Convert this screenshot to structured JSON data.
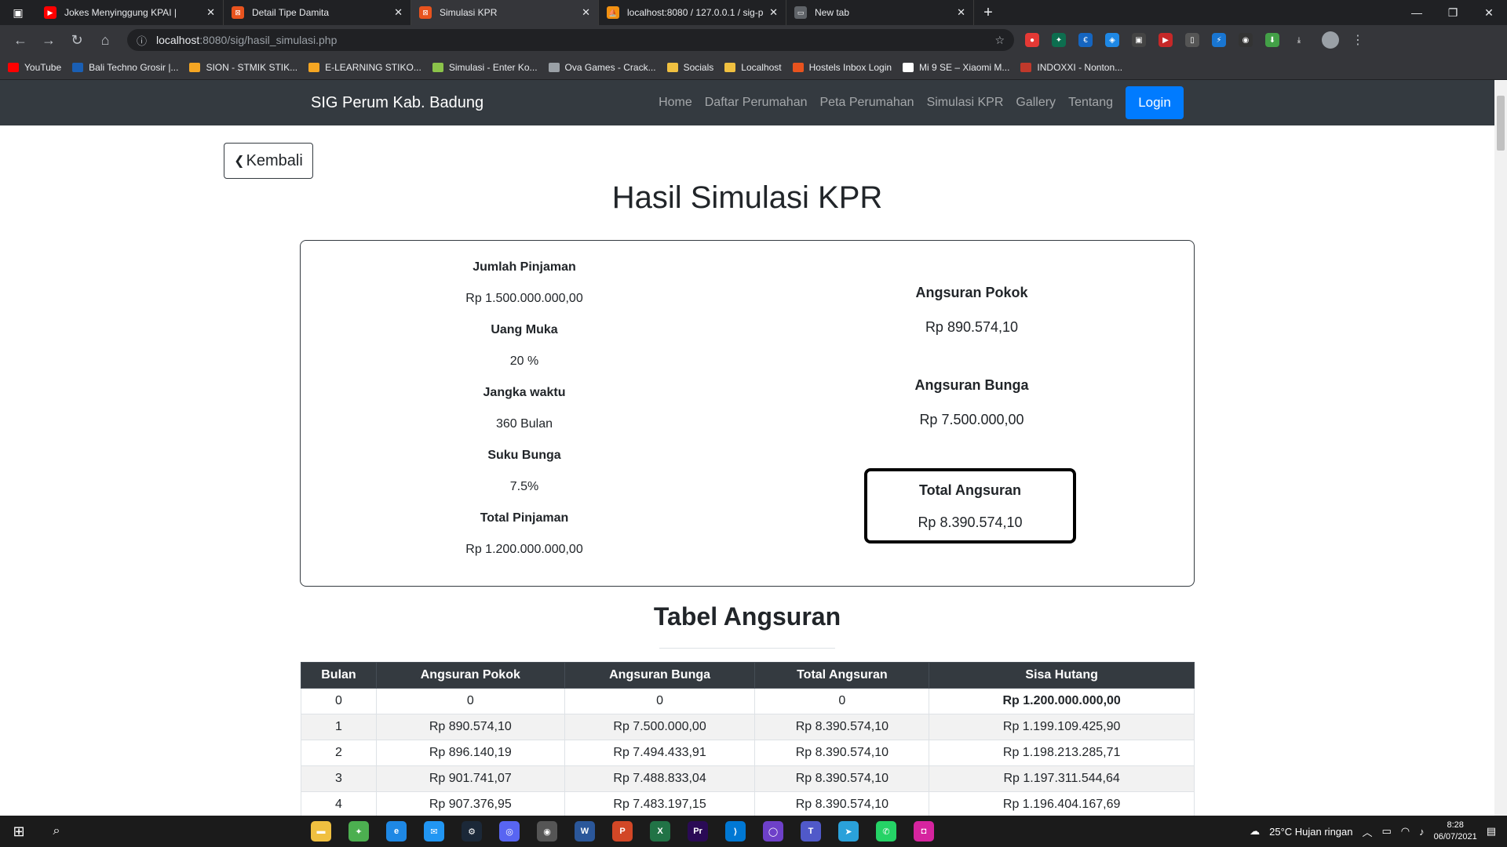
{
  "browser": {
    "tabs": [
      {
        "title": "Jokes Menyinggung KPAI | ",
        "fav_color": "#ff0000",
        "fav_glyph": "▶"
      },
      {
        "title": "Detail Tipe Damita",
        "fav_color": "#e8531e",
        "fav_glyph": "⊠"
      },
      {
        "title": "Simulasi KPR",
        "fav_color": "#e8531e",
        "fav_glyph": "⊠"
      },
      {
        "title": "localhost:8080 / 127.0.0.1 / sig-p",
        "fav_color": "#f29111",
        "fav_glyph": "⛵"
      },
      {
        "title": "New tab",
        "fav_color": "#5f6368",
        "fav_glyph": "▭"
      }
    ],
    "url_host": "localhost",
    "url_path": ":8080/sig/hasil_simulasi.php",
    "bookmarks": [
      {
        "label": "YouTube",
        "color": "#ff0000"
      },
      {
        "label": "Bali Techno Grosir |...",
        "color": "#1a5fb4"
      },
      {
        "label": "SION - STMIK STIK...",
        "color": "#f5a623"
      },
      {
        "label": "E-LEARNING STIKO...",
        "color": "#f5a623"
      },
      {
        "label": "Simulasi - Enter Ko...",
        "color": "#8bc34a"
      },
      {
        "label": "Ova Games - Crack...",
        "color": "#9aa0a6"
      },
      {
        "label": "Socials",
        "color": "#f0c040"
      },
      {
        "label": "Localhost",
        "color": "#f0c040"
      },
      {
        "label": "Hostels Inbox Login",
        "color": "#e8531e"
      },
      {
        "label": "Mi 9 SE – Xiaomi M...",
        "color": "#ffffff"
      },
      {
        "label": "INDOXXI - Nonton...",
        "color": "#c0392b"
      }
    ]
  },
  "navbar": {
    "brand": "SIG Perum Kab. Badung",
    "links": [
      "Home",
      "Daftar Perumahan",
      "Peta Perumahan",
      "Simulasi KPR",
      "Gallery",
      "Tentang"
    ],
    "login": "Login"
  },
  "page": {
    "back": "Kembali",
    "title": "Hasil Simulasi KPR"
  },
  "summary": {
    "left": [
      {
        "label": "Jumlah Pinjaman",
        "value": "Rp 1.500.000.000,00"
      },
      {
        "label": "Uang Muka",
        "value": "20 %"
      },
      {
        "label": "Jangka waktu",
        "value": "360 Bulan"
      },
      {
        "label": "Suku Bunga",
        "value": "7.5%"
      },
      {
        "label": "Total Pinjaman",
        "value": "Rp 1.200.000.000,00"
      }
    ],
    "pokok_label": "Angsuran Pokok",
    "pokok_value": "Rp 890.574,10",
    "bunga_label": "Angsuran Bunga",
    "bunga_value": "Rp 7.500.000,00",
    "total_label": "Total Angsuran",
    "total_value": "Rp 8.390.574,10"
  },
  "table": {
    "title": "Tabel Angsuran",
    "headers": [
      "Bulan",
      "Angsuran Pokok",
      "Angsuran Bunga",
      "Total Angsuran",
      "Sisa Hutang"
    ],
    "rows": [
      [
        "0",
        "0",
        "0",
        "0",
        "Rp 1.200.000.000,00"
      ],
      [
        "1",
        "Rp 890.574,10",
        "Rp 7.500.000,00",
        "Rp 8.390.574,10",
        "Rp 1.199.109.425,90"
      ],
      [
        "2",
        "Rp 896.140,19",
        "Rp 7.494.433,91",
        "Rp 8.390.574,10",
        "Rp 1.198.213.285,71"
      ],
      [
        "3",
        "Rp 901.741,07",
        "Rp 7.488.833,04",
        "Rp 8.390.574,10",
        "Rp 1.197.311.544,64"
      ],
      [
        "4",
        "Rp 907.376,95",
        "Rp 7.483.197,15",
        "Rp 8.390.574,10",
        "Rp 1.196.404.167,69"
      ]
    ]
  },
  "taskbar": {
    "weather": "25°C  Hujan ringan",
    "time": "8:28",
    "date": "06/07/2021",
    "apps": [
      {
        "name": "file-explorer",
        "color": "#f0c040",
        "glyph": "▬"
      },
      {
        "name": "app-2",
        "color": "#4caf50",
        "glyph": "✦"
      },
      {
        "name": "edge",
        "color": "#1e88e5",
        "glyph": "e"
      },
      {
        "name": "chat",
        "color": "#2196f3",
        "glyph": "✉"
      },
      {
        "name": "steam",
        "color": "#1b2838",
        "glyph": "⚙"
      },
      {
        "name": "discord",
        "color": "#5865f2",
        "glyph": "◎"
      },
      {
        "name": "app-7",
        "color": "#555",
        "glyph": "◉"
      },
      {
        "name": "word",
        "color": "#2b579a",
        "glyph": "W"
      },
      {
        "name": "powerpoint",
        "color": "#d24726",
        "glyph": "P"
      },
      {
        "name": "excel",
        "color": "#217346",
        "glyph": "X"
      },
      {
        "name": "premiere",
        "color": "#2a0a55",
        "glyph": "Pr"
      },
      {
        "name": "vscode",
        "color": "#0078d4",
        "glyph": "⟩"
      },
      {
        "name": "github",
        "color": "#6e40c9",
        "glyph": "◯"
      },
      {
        "name": "teams",
        "color": "#5059c9",
        "glyph": "T"
      },
      {
        "name": "telegram",
        "color": "#2aa1da",
        "glyph": "➤"
      },
      {
        "name": "whatsapp",
        "color": "#25d366",
        "glyph": "✆"
      },
      {
        "name": "instagram",
        "color": "#d6249f",
        "glyph": "◘"
      }
    ]
  }
}
